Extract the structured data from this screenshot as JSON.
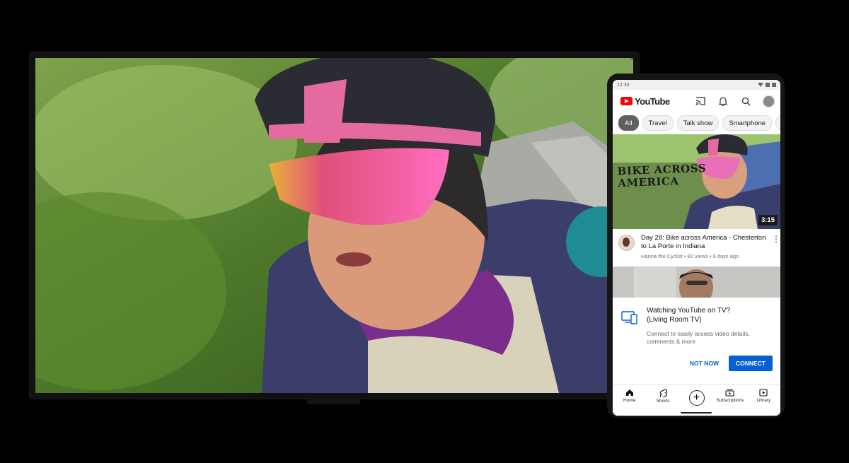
{
  "statusbar": {
    "time": "12:30"
  },
  "header": {
    "logo_text": "YouTube"
  },
  "chips": [
    "All",
    "Travel",
    "Talk show",
    "Smartphone",
    "Ar"
  ],
  "video": {
    "title": "Day 28: Bike across America - Chesterton to La Porte in Indiana",
    "channel_meta": "Hanna the Cyclist • 82 views • 9 days ago",
    "duration": "3:15",
    "thumbnail_text_line1": "BIKE ACROSS",
    "thumbnail_text_line2": "AMERICA"
  },
  "connect_card": {
    "title_line1": "Watching YouTube on TV?",
    "title_line2": "(Living Room TV)",
    "description": "Connect to easily access video details, comments & more",
    "not_now_label": "NOT NOW",
    "connect_label": "CONNECT"
  },
  "bottom_nav": {
    "home": "Home",
    "shorts": "Shorts",
    "subscriptions": "Subscriptions",
    "library": "Library"
  },
  "colors": {
    "brand_red": "#ff0000",
    "accent_blue": "#065fd4",
    "chip_active": "#606060"
  },
  "icons": [
    "cast-icon",
    "bell-icon",
    "search-icon",
    "home-icon",
    "shorts-icon",
    "create-icon",
    "subscriptions-icon",
    "library-icon",
    "tv-phone-icon"
  ]
}
